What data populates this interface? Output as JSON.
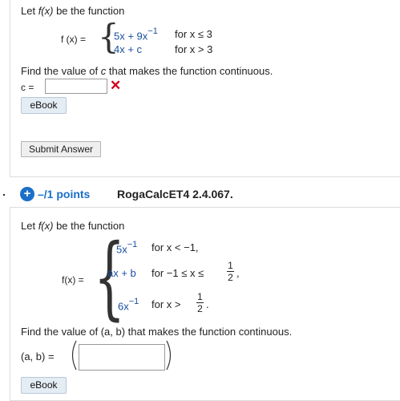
{
  "q1": {
    "intro_prefix": "Let ",
    "intro_func": "f(x)",
    "intro_suffix": " be the function",
    "lhs": "f (x) =",
    "case1_expr": "5x + 9x",
    "case1_exp": "−1",
    "case1_cond": "for  x ≤ 3",
    "case2_expr": "4x + c",
    "case2_cond": "for  x > 3",
    "prompt_prefix": "Find the value of ",
    "prompt_var": "c",
    "prompt_suffix": " that makes the function continuous.",
    "answer_label": "c =",
    "answer_value": "",
    "incorrect_mark": "✕",
    "ebook_label": "eBook",
    "submit_label": "Submit Answer"
  },
  "q2": {
    "bullet": ".",
    "points_icon": "+",
    "points_label": "–/1 points",
    "question_id": "RogaCalcET4 2.4.067.",
    "intro_prefix": "Let ",
    "intro_func": "f(x)",
    "intro_suffix": " be the function",
    "lhs": "f(x) =",
    "case1_expr": "5x",
    "case1_exp": "−1",
    "case1_cond": "for  x < −1,",
    "case2_expr": "ax + b",
    "case2_cond": "for  −1 ≤ x ≤",
    "case2_frac_num": "1",
    "case2_frac_den": "2",
    "case2_tail": ",",
    "case3_expr": "6x",
    "case3_exp": "−1",
    "case3_cond": "for  x >",
    "case3_frac_num": "1",
    "case3_frac_den": "2",
    "case3_tail": ".",
    "prompt": "Find the value of (a, b) that makes the function continuous.",
    "answer_label": "(a, b) =",
    "answer_value": "",
    "ebook_label": "eBook"
  },
  "colors": {
    "accent_blue": "#1a6fc9",
    "error_red": "#d0021b",
    "expr_blue": "#1a4fa0"
  }
}
